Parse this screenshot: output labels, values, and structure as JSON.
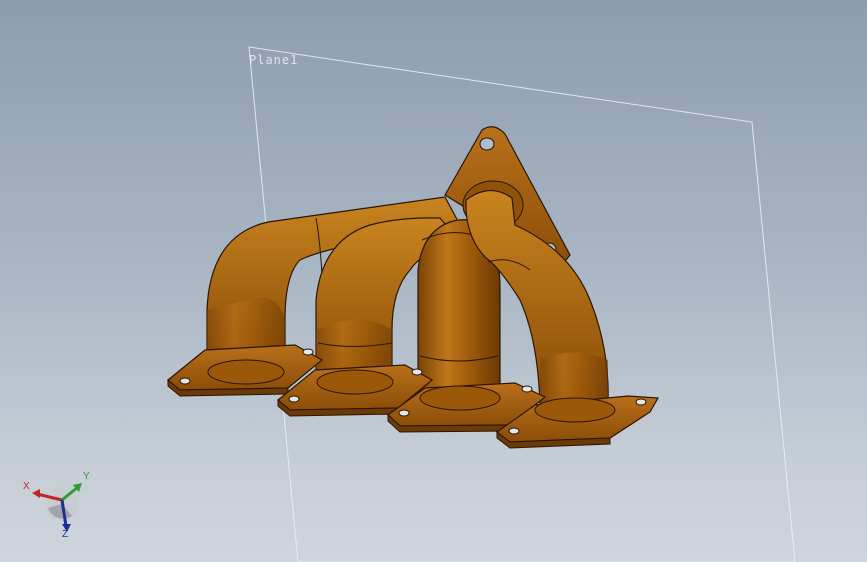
{
  "viewport": {
    "plane_label": "Plane1",
    "model_color": "#b56a0c",
    "background_top": "#8d9db0",
    "background_bottom": "#cfd5dc"
  },
  "triad": {
    "x_label": "X",
    "y_label": "Y",
    "z_label": "Z",
    "x_color": "#c0262a",
    "y_color": "#2f9e2f",
    "z_color": "#1d2f8f"
  }
}
